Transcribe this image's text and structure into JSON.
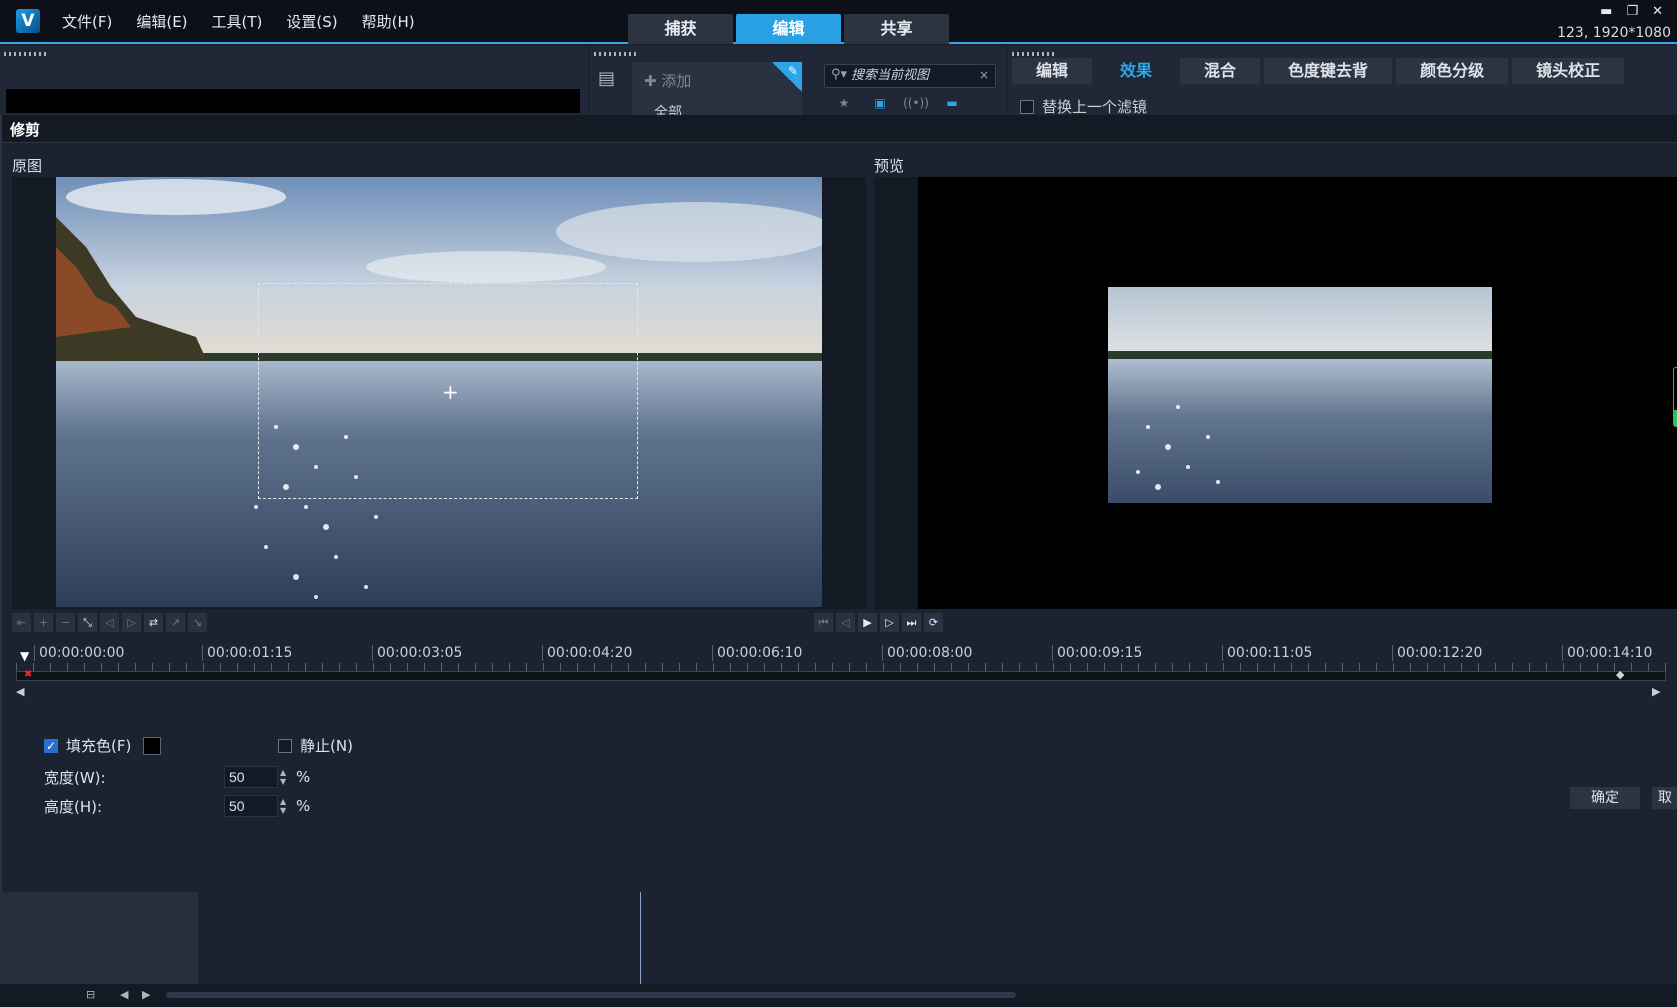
{
  "menu": [
    "文件(F)",
    "编辑(E)",
    "工具(T)",
    "设置(S)",
    "帮助(H)"
  ],
  "mode_tabs": [
    "捕获",
    "编辑",
    "共享"
  ],
  "project_info": "123, 1920*1080",
  "library": {
    "add_label": "添加",
    "all_label": "全部",
    "search_placeholder": "搜索当前视图"
  },
  "option_tabs": [
    "编辑",
    "效果",
    "混合",
    "色度键去背",
    "颜色分级",
    "镜头校正"
  ],
  "replace_filter_label": "替换上一个滤镜",
  "dialog": {
    "title": "修剪",
    "source_label": "原图",
    "preview_label": "预览"
  },
  "timecodes": [
    "00:00:00:00",
    "00:00:01:15",
    "00:00:03:05",
    "00:00:04:20",
    "00:00:06:10",
    "00:00:08:00",
    "00:00:09:15",
    "00:00:11:05",
    "00:00:12:20",
    "00:00:14:10"
  ],
  "options": {
    "fill_color_label": "填充色(F)",
    "fill_color_checked": true,
    "fill_color_value": "#000000",
    "still_label": "静止(N)",
    "still_checked": false,
    "width_label": "宽度(W):",
    "width_value": "50",
    "height_label": "高度(H):",
    "height_value": "50",
    "unit": "%",
    "ok_label": "确定",
    "cancel_label": "取"
  },
  "colors": {
    "accent": "#2aa0e4",
    "panel": "#202837",
    "bg": "#1b2230"
  }
}
